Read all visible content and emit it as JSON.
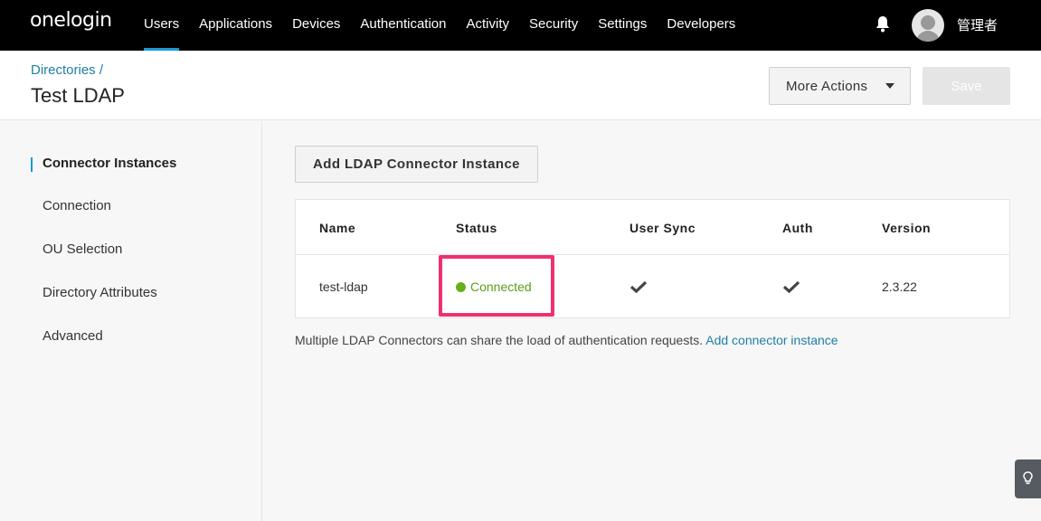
{
  "brand": {
    "logo_text": "onelogin"
  },
  "nav": {
    "items": [
      {
        "label": "Users",
        "active": true
      },
      {
        "label": "Applications"
      },
      {
        "label": "Devices"
      },
      {
        "label": "Authentication"
      },
      {
        "label": "Activity"
      },
      {
        "label": "Security"
      },
      {
        "label": "Settings"
      },
      {
        "label": "Developers"
      }
    ],
    "username": "管理者"
  },
  "header": {
    "breadcrumb": "Directories",
    "breadcrumb_sep": "/",
    "title": "Test LDAP",
    "more_actions_label": "More Actions",
    "save_label": "Save"
  },
  "sidebar": {
    "items": [
      {
        "label": "Connector Instances",
        "active": true
      },
      {
        "label": "Connection"
      },
      {
        "label": "OU Selection"
      },
      {
        "label": "Directory Attributes"
      },
      {
        "label": "Advanced"
      }
    ]
  },
  "main": {
    "add_button_label": "Add LDAP Connector Instance",
    "table": {
      "columns": [
        "Name",
        "Status",
        "User Sync",
        "Auth",
        "Version"
      ],
      "rows": [
        {
          "name": "test-ldap",
          "status": "Connected",
          "user_sync": true,
          "auth": true,
          "version": "2.3.22"
        }
      ]
    },
    "help_text": "Multiple LDAP Connectors can share the load of authentication requests.",
    "help_link": "Add connector instance"
  },
  "colors": {
    "accent": "#1b9ad6",
    "link": "#1d7fa6",
    "status_connected": "#64b01e",
    "highlight": "#f0316f"
  },
  "icons": [
    "bell-icon",
    "avatar-icon",
    "caret-down-icon",
    "check-icon",
    "lightbulb-icon"
  ]
}
